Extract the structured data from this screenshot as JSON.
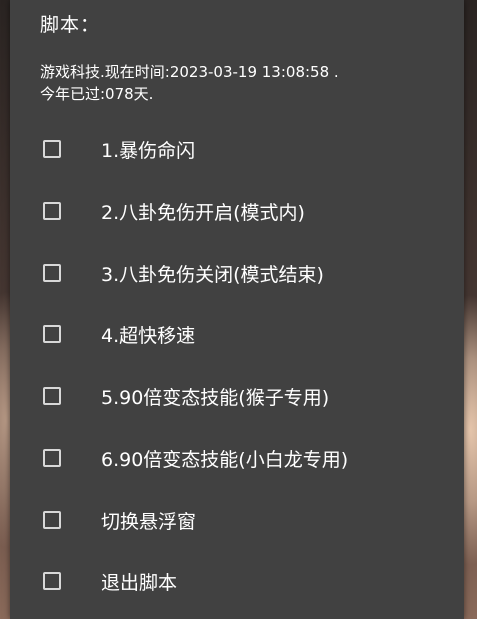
{
  "dialog": {
    "title": "脚本：",
    "info_line1": "游戏科技.现在时间:2023-03-19 13:08:58 .",
    "info_line2": "今年已过:078天."
  },
  "options": [
    {
      "label": "1.暴伤命闪",
      "checked": false
    },
    {
      "label": "2.八卦免伤开启(模式内)",
      "checked": false
    },
    {
      "label": "3.八卦免伤关闭(模式结束)",
      "checked": false
    },
    {
      "label": "4.超快移速",
      "checked": false
    },
    {
      "label": "5.90倍变态技能(猴子专用)",
      "checked": false
    },
    {
      "label": "6.90倍变态技能(小白龙专用)",
      "checked": false
    },
    {
      "label": "切换悬浮窗",
      "checked": false
    },
    {
      "label": "退出脚本",
      "checked": false
    }
  ]
}
